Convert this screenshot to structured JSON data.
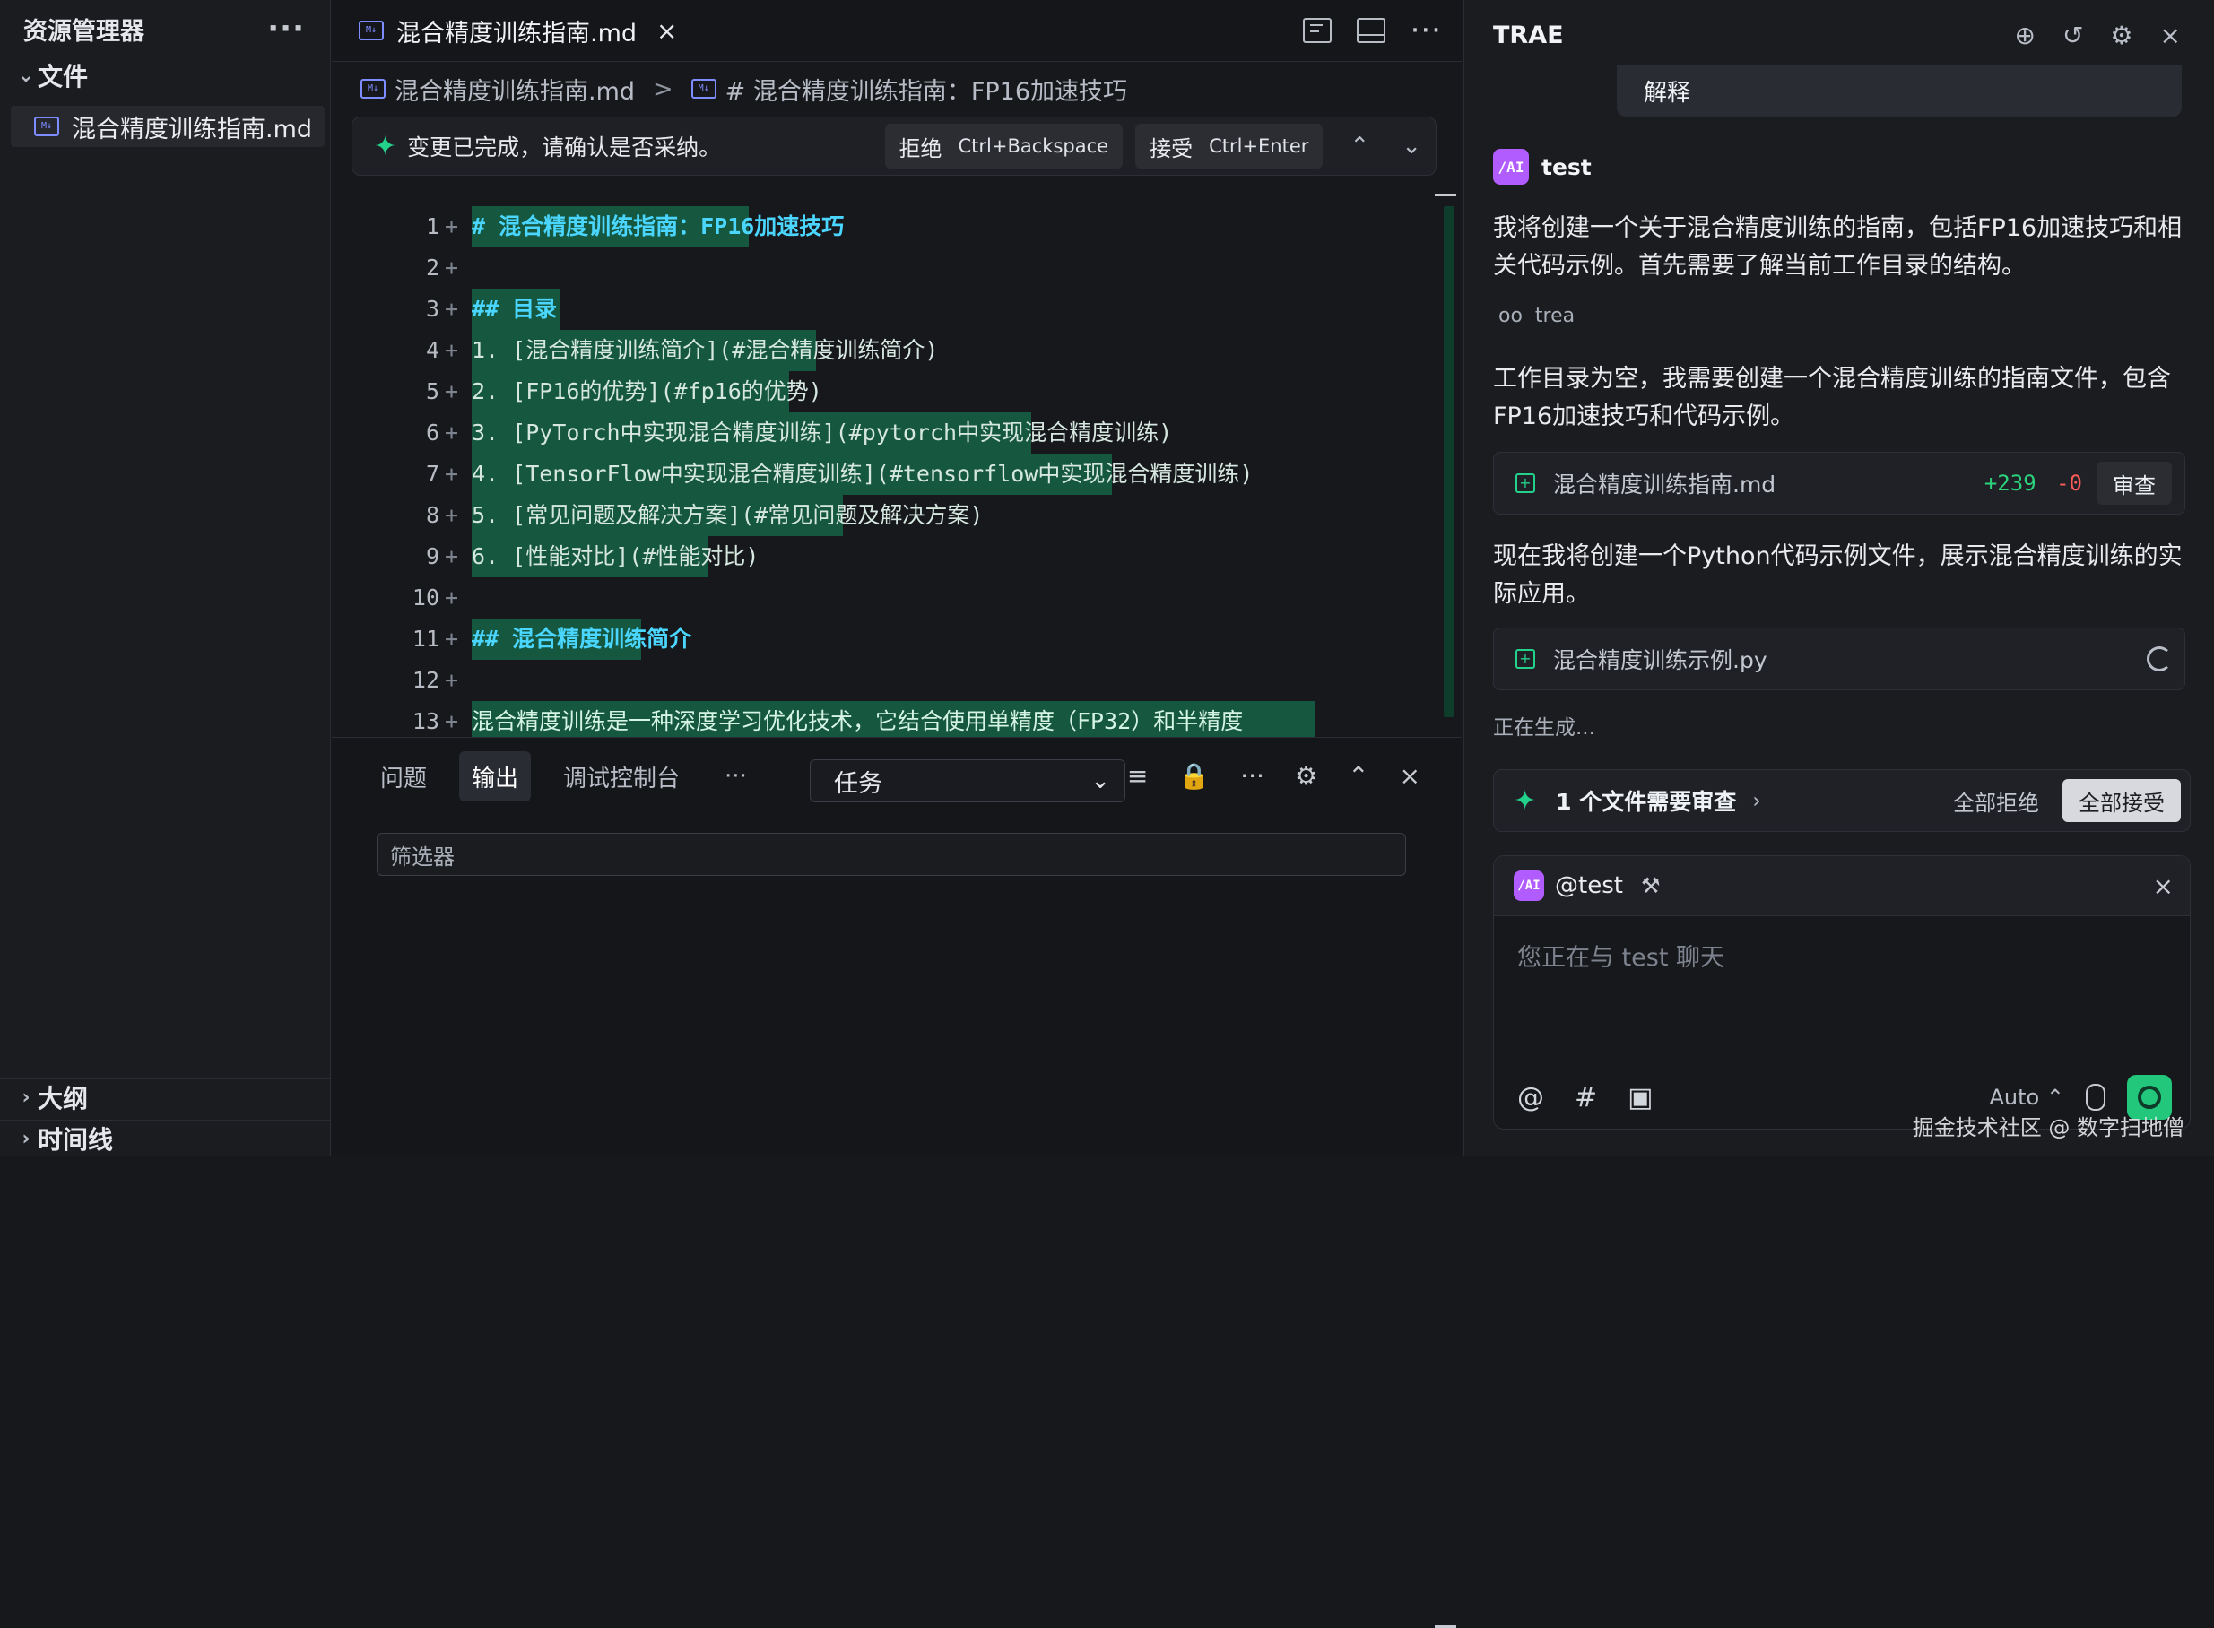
{
  "explorer": {
    "title": "资源管理器",
    "more": "···",
    "files_section": "文件",
    "file_name": "混合精度训练指南.md",
    "outline": "大纲",
    "timeline": "时间线"
  },
  "editor": {
    "tab_title": "混合精度训练指南.md",
    "tab_close": "×",
    "breadcrumb_file": "混合精度训练指南.md",
    "breadcrumb_sep": ">",
    "breadcrumb_heading": "# 混合精度训练指南：FP16加速技巧",
    "diff_banner": {
      "message": "变更已完成，请确认是否采纳。",
      "reject": "拒绝",
      "reject_key": "Ctrl+Backspace",
      "accept": "接受",
      "accept_key": "Ctrl+Enter"
    },
    "lines": [
      {
        "n": "1",
        "text": "# 混合精度训练指南：FP16加速技巧",
        "kind": "h"
      },
      {
        "n": "2",
        "text": "",
        "kind": "blank"
      },
      {
        "n": "3",
        "text": "## 目录",
        "kind": "h"
      },
      {
        "n": "4",
        "text": "1. [混合精度训练简介](#混合精度训练简介)",
        "kind": "list"
      },
      {
        "n": "5",
        "text": "2. [FP16的优势](#fp16的优势)",
        "kind": "list"
      },
      {
        "n": "6",
        "text": "3. [PyTorch中实现混合精度训练](#pytorch中实现混合精度训练)",
        "kind": "list"
      },
      {
        "n": "7",
        "text": "4. [TensorFlow中实现混合精度训练](#tensorflow中实现混合精度训练)",
        "kind": "list"
      },
      {
        "n": "8",
        "text": "5. [常见问题及解决方案](#常见问题及解决方案)",
        "kind": "list"
      },
      {
        "n": "9",
        "text": "6. [性能对比](#性能对比)",
        "kind": "list"
      },
      {
        "n": "10",
        "text": "",
        "kind": "blank"
      },
      {
        "n": "11",
        "text": "## 混合精度训练简介",
        "kind": "h"
      },
      {
        "n": "12",
        "text": "",
        "kind": "blank"
      },
      {
        "n": "13",
        "text": "混合精度训练是一种深度学习优化技术，它结合使用单精度（FP32）和半精度",
        "kind": "p"
      }
    ]
  },
  "panel": {
    "tabs": [
      "问题",
      "输出",
      "调试控制台"
    ],
    "tabs_more": "···",
    "task_select": "任务",
    "filter_placeholder": "筛选器"
  },
  "chat": {
    "title": "TRAE",
    "quote": "解释",
    "agent_name": "test",
    "msg1": "我将创建一个关于混合精度训练的指南，包括FP16加速技巧和相关代码示例。首先需要了解当前工作目录的结构。",
    "tool_name": "trea",
    "msg2": "工作目录为空，我需要创建一个混合精度训练的指南文件，包含FP16加速技巧和代码示例。",
    "file1": {
      "name": "混合精度训练指南.md",
      "add": "+239",
      "del": "-0",
      "review": "审查"
    },
    "msg3": "现在我将创建一个Python代码示例文件，展示混合精度训练的实际应用。",
    "file2": {
      "name": "混合精度训练示例.py"
    },
    "generating": "正在生成...",
    "review_bar": {
      "text": "1 个文件需要审查",
      "reject_all": "全部拒绝",
      "accept_all": "全部接受"
    },
    "composer": {
      "mention": "@test",
      "placeholder": "您正在与 test 聊天",
      "model": "Auto",
      "close": "×"
    },
    "watermark": "掘金技术社区 @ 数字扫地僧"
  },
  "colors": {
    "accent": "#24d18b",
    "diff_bg": "#15573f",
    "background": "#17181b"
  },
  "icons": {
    "file_md": "markdown-file-icon",
    "sparkle": "sparkle-icon",
    "chevron": "chevron-icon",
    "close": "close-icon"
  }
}
